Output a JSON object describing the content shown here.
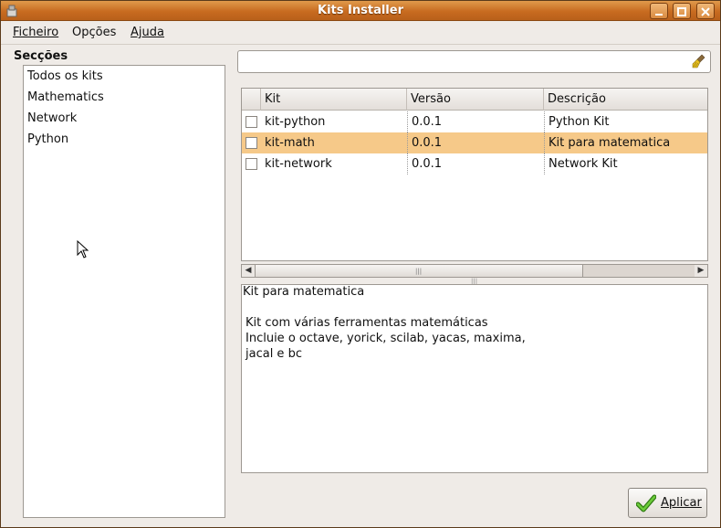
{
  "window": {
    "title": "Kits Installer"
  },
  "menu": [
    {
      "label": "Ficheiro"
    },
    {
      "label": "Opções"
    },
    {
      "label": "Ajuda"
    }
  ],
  "sections": {
    "heading": "Secções",
    "items": [
      "Todos os kits",
      "Mathematics",
      "Network",
      "Python"
    ]
  },
  "search": {
    "value": "",
    "placeholder": ""
  },
  "table": {
    "columns": [
      "Kit",
      "Versão",
      "Descrição"
    ],
    "rows": [
      {
        "kit": "kit-python",
        "version": "0.0.1",
        "description": "Python Kit",
        "checked": false,
        "selected": false
      },
      {
        "kit": "kit-math",
        "version": "0.0.1",
        "description": "Kit para matematica",
        "checked": false,
        "selected": true
      },
      {
        "kit": "kit-network",
        "version": "0.0.1",
        "description": "Network Kit",
        "checked": false,
        "selected": false
      }
    ]
  },
  "description": {
    "lines": [
      "Kit para matematica",
      "",
      "Kit com várias ferramentas matemáticas",
      "Incluie o octave, yorick, scilab, yacas, maxima,",
      "jacal e bc"
    ]
  },
  "apply_button": {
    "label": "Aplicar"
  },
  "colors": {
    "titlebar": "#c86b20",
    "selection": "#f6c989",
    "check_green": "#3a9a1a"
  }
}
